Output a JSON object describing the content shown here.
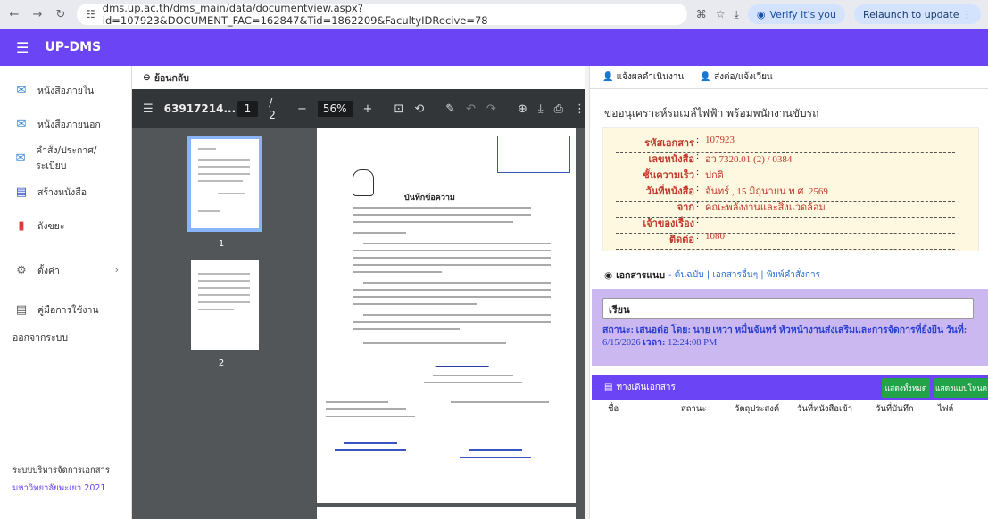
{
  "browser": {
    "url": "dms.up.ac.th/dms_main/data/documentview.aspx?id=107923&DOCUMENT_FAC=162847&Tid=1862209&FacultyIDRecive=78",
    "verify_label": "Verify it's you",
    "relaunch_label": "Relaunch to update"
  },
  "app": {
    "brand": "UP-DMS"
  },
  "sidebar": {
    "items": [
      {
        "label": "หนังสือภายใน",
        "icon": "inbox-envelope-icon"
      },
      {
        "label": "หนังสือภายนอก",
        "icon": "outbox-envelope-icon"
      },
      {
        "label": "คำสั่ง/ประกาศ/ระเบียบ",
        "icon": "announcement-icon"
      },
      {
        "label": "สร้างหนังสือ",
        "icon": "create-document-icon"
      },
      {
        "label": "ถังขยะ",
        "icon": "trash-icon"
      },
      {
        "label": "ตั้งค่า",
        "icon": "gear-icon"
      },
      {
        "label": "คู่มือการใช้งาน",
        "icon": "manual-icon"
      },
      {
        "label": "ออกจากระบบ",
        "icon": ""
      }
    ],
    "footer_system": "ระบบบริหารจัดการเอกสาร",
    "footer_org": "มหาวิทยาลัยพะเยา 2021"
  },
  "back": {
    "label": "ย้อนกลับ"
  },
  "viewer": {
    "file_title": "63917214...",
    "current_page": "1",
    "total_pages": "/ 2",
    "zoom": "56%",
    "thumb_labels": [
      "1",
      "2"
    ]
  },
  "document": {
    "memo_heading": "บันทึกข้อความ"
  },
  "actions": {
    "report": "แจ้งผลดำเนินงาน",
    "forward": "ส่งต่อ/แจ้งเวียน"
  },
  "detail": {
    "title": "ขออนุเคราะห์รถเมล์ไฟฟ้า พร้อมพนักงานขับรถ",
    "rows": [
      {
        "key": "รหัสเอกสาร",
        "value": "107923"
      },
      {
        "key": "เลขหนังสือ",
        "value": "อว 7320.01 (2) / 0384"
      },
      {
        "key": "ชั้นความเร็ว",
        "value": "ปกติ"
      },
      {
        "key": "วันที่หนังสือ",
        "value": "จันทร์ , 15 มิถุนายน พ.ศ. 2569"
      },
      {
        "key": "จาก",
        "value": "คณะพลังงานและสิ่งแวดล้อม"
      },
      {
        "key": "เจ้าของเรื่อง",
        "value": ""
      },
      {
        "key": "ติดต่อ",
        "value": "1080"
      }
    ]
  },
  "attachments": {
    "label": "เอกสารแนบ",
    "links": "- ต้นฉบับ | เอกสารอื่นๆ | พิมพ์คำสั่งการ"
  },
  "comment": {
    "value": "เรียน",
    "status_prefix": "สถานะ: เสนอต่อ",
    "by_prefix": "โดย:",
    "by_value": "นาย เหวา หมื่นจันทร์ หัวหน้างานส่งเสริมและการจัดการที่ยั่งยืน",
    "date_label": "วันที่:",
    "date_value": "6/15/2026",
    "time_label": "เวลา:",
    "time_value": "12:24:08 PM"
  },
  "route": {
    "title": "ทางเดินเอกสาร",
    "btn_all": "แสดงทั้งหมด",
    "btn_tree": "แสดงแบบโหนด",
    "columns": [
      "ชื่อ",
      "สถานะ",
      "วัตถุประสงค์",
      "วันที่หนังสือเข้า",
      "วันที่บันทึก",
      "ไฟล์"
    ]
  },
  "colors": {
    "accent": "#6b45f5",
    "info_bg": "#fff8e1",
    "comment_bg": "#ccb8f0",
    "button_green": "#22a349"
  }
}
